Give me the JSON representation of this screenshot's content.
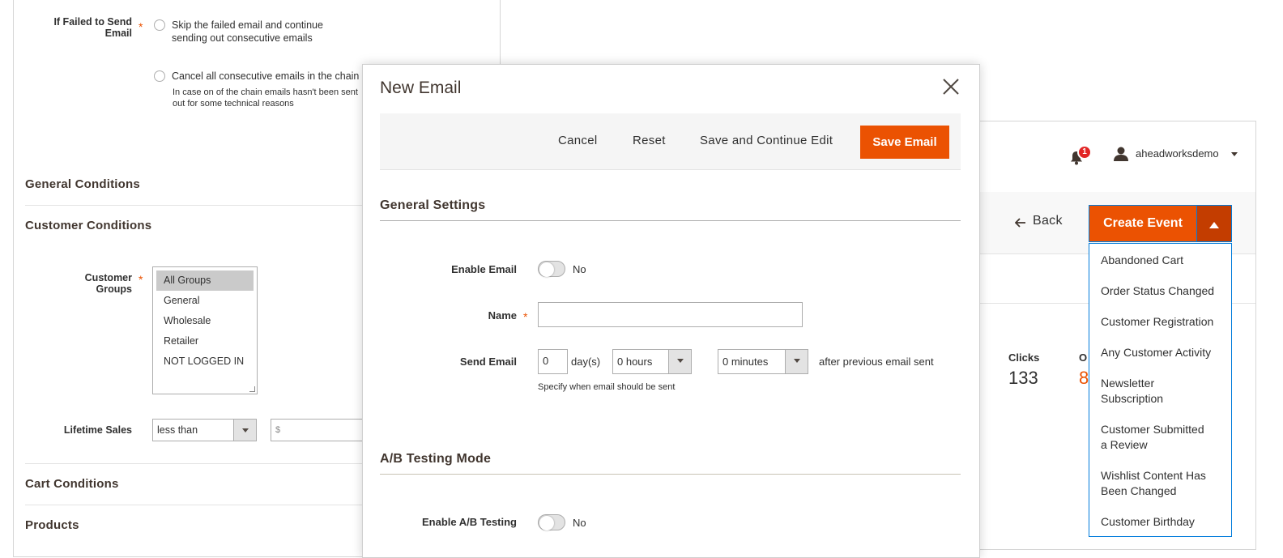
{
  "left_panel": {
    "if_failed_label": "If Failed to Send Email",
    "if_failed_label_line1": "If Failed to Send",
    "if_failed_label_line2": "Email",
    "option_skip_line1": "Skip the failed email and continue",
    "option_skip_line2": "sending out consecutive emails",
    "option_cancel": "Cancel all consecutive emails in the chain",
    "option_cancel_note_line1": "In case on of the chain emails hasn't been sent",
    "option_cancel_note_line2": "out for some technical reasons",
    "section_general_conditions": "General Conditions",
    "section_customer_conditions": "Customer Conditions",
    "customer_groups_label": "Customer Groups",
    "customer_groups": [
      "All Groups",
      "General",
      "Wholesale",
      "Retailer",
      "NOT LOGGED IN"
    ],
    "customer_groups_selected": "All Groups",
    "lifetime_sales_label": "Lifetime Sales",
    "lifetime_sales_operator": "less than",
    "lifetime_sales_value_placeholder": "$",
    "section_cart_conditions": "Cart Conditions",
    "section_products": "Products"
  },
  "right_panel": {
    "notification_count": "1",
    "username": "aheadworksdemo",
    "back_label": "Back",
    "create_event_label": "Create Event",
    "stats_clicks_label": "Clicks",
    "stats_clicks_value": "133",
    "stats_next_label": "O",
    "stats_next_value": "8",
    "event_types": [
      "Abandoned Cart",
      "Order Status Changed",
      "Customer Registration",
      "Any Customer Activity",
      "Newsletter Subscription",
      "Customer Submitted a Review",
      "Wishlist Content Has Been Changed",
      "Customer Birthday"
    ],
    "event_types_lines": [
      [
        "Abandoned Cart"
      ],
      [
        "Order Status Changed"
      ],
      [
        "Customer Registration"
      ],
      [
        "Any Customer Activity"
      ],
      [
        "Newsletter",
        "Subscription"
      ],
      [
        "Customer Submitted",
        "a Review"
      ],
      [
        "Wishlist Content Has",
        "Been Changed"
      ],
      [
        "Customer Birthday"
      ]
    ]
  },
  "modal": {
    "title": "New Email",
    "cancel_label": "Cancel",
    "reset_label": "Reset",
    "save_continue_label": "Save and Continue Edit",
    "save_email_label": "Save Email",
    "general_settings_title": "General Settings",
    "enable_email_label": "Enable Email",
    "enable_email_value": "No",
    "name_label": "Name",
    "name_value": "",
    "send_email_label": "Send Email",
    "days_value": "0",
    "days_suffix": "day(s)",
    "hours_value": "0 hours",
    "minutes_value": "0 minutes",
    "after_text": "after previous email sent",
    "send_email_note": "Specify when email should be sent",
    "ab_testing_title": "A/B Testing Mode",
    "enable_ab_label": "Enable A/B Testing",
    "enable_ab_value": "No"
  },
  "colors": {
    "accent": "#eb5202",
    "accent_dark": "#c33d00",
    "text": "#303030",
    "border": "#adadad",
    "dropdown_border": "#007bdb"
  }
}
